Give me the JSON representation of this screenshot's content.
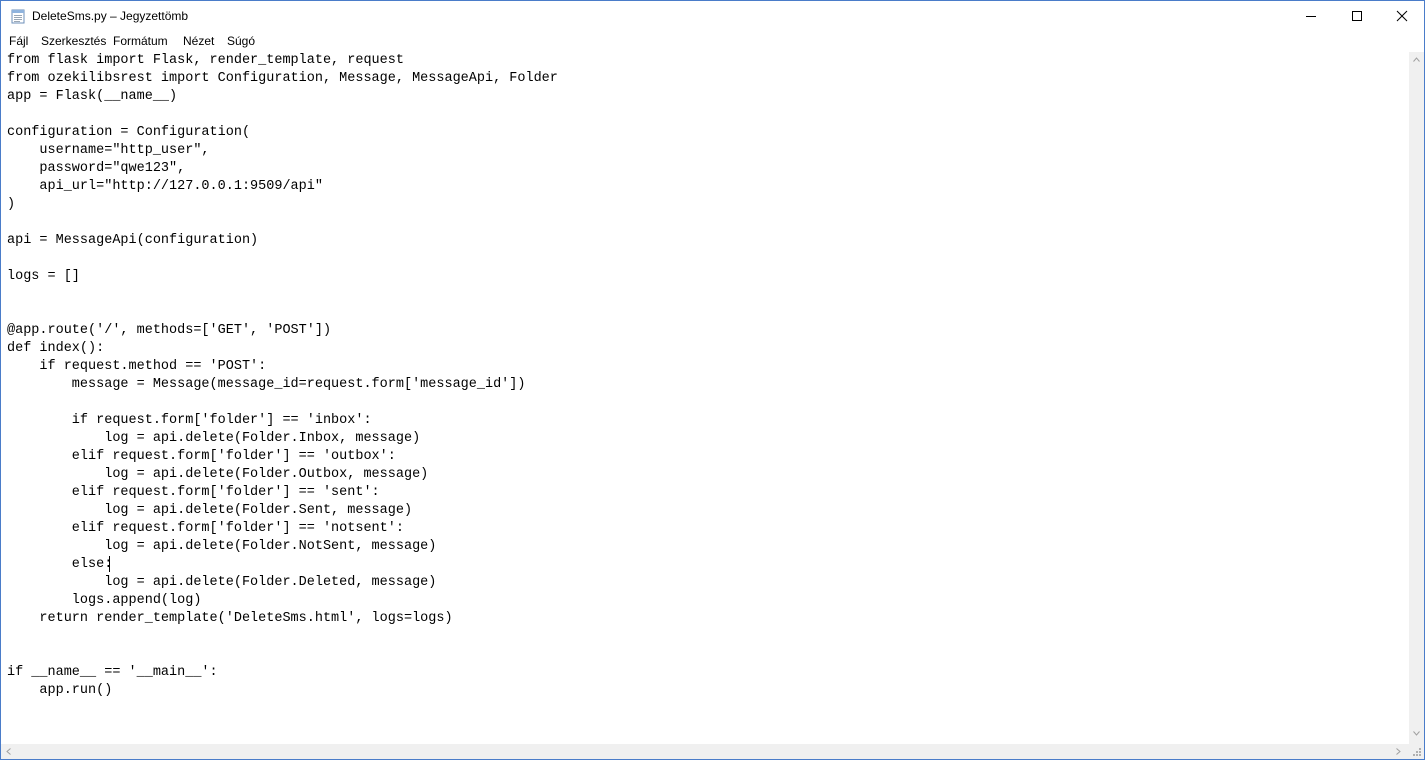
{
  "window": {
    "title": "DeleteSms.py – Jegyzettömb"
  },
  "menu": [
    {
      "label": "Fájl"
    },
    {
      "label": "Szerkesztés"
    },
    {
      "label": "Formátum"
    },
    {
      "label": "Nézet"
    },
    {
      "label": "Súgó"
    }
  ],
  "editor": {
    "lines": [
      "from flask import Flask, render_template, request",
      "from ozekilibsrest import Configuration, Message, MessageApi, Folder",
      "app = Flask(__name__)",
      "",
      "configuration = Configuration(",
      "    username=\"http_user\",",
      "    password=\"qwe123\",",
      "    api_url=\"http://127.0.0.1:9509/api\"",
      ")",
      "",
      "api = MessageApi(configuration)",
      "",
      "logs = []",
      "",
      "",
      "@app.route('/', methods=['GET', 'POST'])",
      "def index():",
      "    if request.method == 'POST':",
      "        message = Message(message_id=request.form['message_id'])",
      "",
      "        if request.form['folder'] == 'inbox':",
      "            log = api.delete(Folder.Inbox, message)",
      "        elif request.form['folder'] == 'outbox':",
      "            log = api.delete(Folder.Outbox, message)",
      "        elif request.form['folder'] == 'sent':",
      "            log = api.delete(Folder.Sent, message)",
      "        elif request.form['folder'] == 'notsent':",
      "            log = api.delete(Folder.NotSent, message)",
      "        else:",
      "            log = api.delete(Folder.Deleted, message)",
      "        logs.append(log)",
      "    return render_template('DeleteSms.html', logs=logs)",
      "",
      "",
      "if __name__ == '__main__':",
      "    app.run()"
    ]
  },
  "icons": {
    "app": "notepad-icon",
    "minimize": "minimize-icon",
    "maximize": "maximize-icon",
    "close": "close-icon"
  },
  "colors": {
    "window_border": "#4a7cc9",
    "scrollbar_track": "#f0f0f0",
    "text": "#000000"
  }
}
